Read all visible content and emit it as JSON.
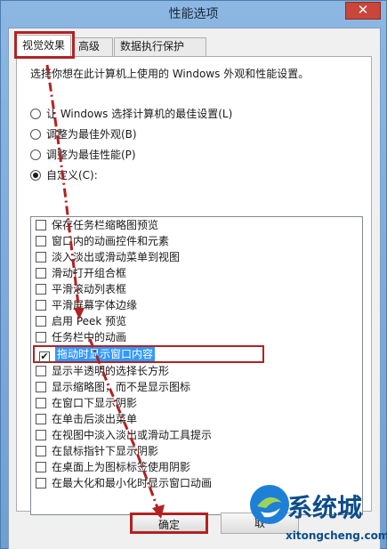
{
  "window": {
    "title": "性能选项",
    "close_label": "✕"
  },
  "tabs": [
    {
      "label": "视觉效果",
      "active": true
    },
    {
      "label": "高级",
      "active": false
    },
    {
      "label": "数据执行保护",
      "active": false
    }
  ],
  "intro": "选择你想在此计算机上使用的 Windows 外观和性能设置。",
  "radios": [
    {
      "label": "让 Windows 选择计算机的最佳设置(L)",
      "checked": false
    },
    {
      "label": "调整为最佳外观(B)",
      "checked": false
    },
    {
      "label": "调整为最佳性能(P)",
      "checked": false
    },
    {
      "label": "自定义(C):",
      "checked": true
    }
  ],
  "options": [
    {
      "label": "保存任务栏缩略图预览",
      "checked": false
    },
    {
      "label": "窗口内的动画控件和元素",
      "checked": false
    },
    {
      "label": "淡入淡出或滑动菜单到视图",
      "checked": false
    },
    {
      "label": "滑动打开组合框",
      "checked": false
    },
    {
      "label": "平滑滚动列表框",
      "checked": false
    },
    {
      "label": "平滑屏幕字体边缘",
      "checked": false
    },
    {
      "label": "启用 Peek 预览",
      "checked": false
    },
    {
      "label": "任务栏中的动画",
      "checked": false
    },
    {
      "label": "拖动时显示窗口内容",
      "checked": true
    },
    {
      "label": "显示半透明的选择长方形",
      "checked": false
    },
    {
      "label": "显示缩略图，而不是显示图标",
      "checked": false
    },
    {
      "label": "在窗口下显示阴影",
      "checked": false
    },
    {
      "label": "在单击后淡出菜单",
      "checked": false
    },
    {
      "label": "在视图中淡入淡出或滑动工具提示",
      "checked": false
    },
    {
      "label": "在鼠标指针下显示阴影",
      "checked": false
    },
    {
      "label": "在桌面上为图标标签使用阴影",
      "checked": false
    },
    {
      "label": "在最大化和最小化时显示窗口动画",
      "checked": false
    }
  ],
  "buttons": {
    "ok": "确定",
    "cancel": "取"
  },
  "watermark": {
    "brand": "系统城",
    "url": "xitongcheng.com"
  },
  "colors": {
    "annotation": "#b22222",
    "selection": "#3399ff"
  }
}
